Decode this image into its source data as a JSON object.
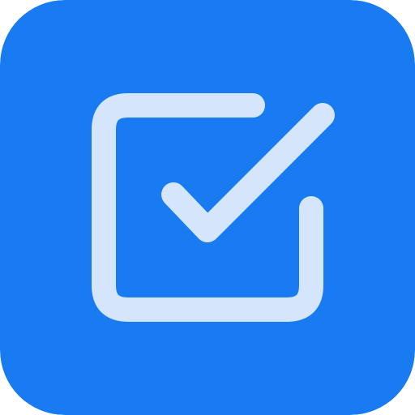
{
  "app_icon": {
    "icon_name": "checkbox-checked-icon",
    "colors": {
      "background": "#187BF2",
      "glyph": "#D5E6FC"
    }
  }
}
